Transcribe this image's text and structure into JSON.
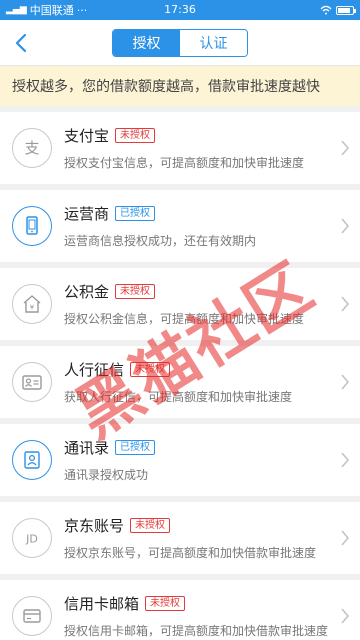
{
  "status_bar": {
    "carrier": "中国联通",
    "dots": "···",
    "time": "17:36"
  },
  "nav": {
    "tabs": [
      {
        "label": "授权"
      },
      {
        "label": "认证"
      }
    ]
  },
  "notice": "授权越多，您的借款额度越高，借款审批速度越快",
  "items": [
    {
      "name": "支付宝",
      "badge": "未授权",
      "desc": "授权支付宝信息，可提高额度和加快审批速度",
      "icon": "alipay-icon",
      "status": "no"
    },
    {
      "name": "运营商",
      "badge": "已授权",
      "desc": "运营商信息授权成功，还在有效期内",
      "icon": "phone-icon",
      "status": "yes"
    },
    {
      "name": "公积金",
      "badge": "未授权",
      "desc": "授权公积金信息，可提高额度和加快审批速度",
      "icon": "house-fund-icon",
      "status": "no"
    },
    {
      "name": "人行征信",
      "badge": "未授权",
      "desc": "获取人行征信，可提高额度和加快审批速度",
      "icon": "id-card-icon",
      "status": "no"
    },
    {
      "name": "通讯录",
      "badge": "已授权",
      "desc": "通讯录授权成功",
      "icon": "contacts-icon",
      "status": "yes"
    },
    {
      "name": "京东账号",
      "badge": "未授权",
      "desc": "授权京东账号，可提高额度和加快借款审批速度",
      "icon": "jd-icon",
      "status": "no"
    },
    {
      "name": "信用卡邮箱",
      "badge": "未授权",
      "desc": "授权信用卡邮箱，可提高额度和加快借款审批速度",
      "icon": "credit-card-icon",
      "status": "no"
    }
  ],
  "watermark": "黑猫社区",
  "colors": {
    "primary": "#2c92e8",
    "unauthorized": "#e33a3a",
    "notice_bg": "#fdf4d6"
  }
}
